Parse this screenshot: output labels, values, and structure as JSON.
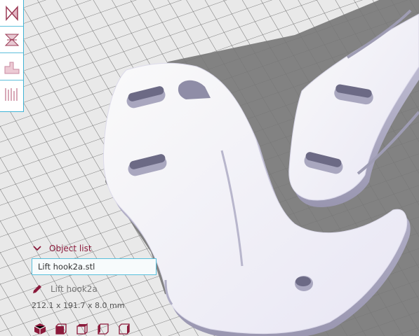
{
  "object_panel": {
    "title": "Object list",
    "selected_file": "Lift hook2a.stl",
    "object_name": "Lift hook2a",
    "dimensions": "212.1 x 191.7 x 8.0 mm"
  },
  "toolbar": {
    "tools": [
      "mirror-tool-icon",
      "support-blocker-icon",
      "layer-stairs-icon",
      "per-model-settings-icon"
    ]
  },
  "view_buttons": [
    "3d-view-icon",
    "front-view-icon",
    "top-view-icon",
    "left-view-icon",
    "right-view-icon"
  ],
  "colors": {
    "accent": "#8b1a3b",
    "highlight": "#3fb4d6",
    "build_plate": "#e9e9e9",
    "model": "#f2f0fa"
  }
}
